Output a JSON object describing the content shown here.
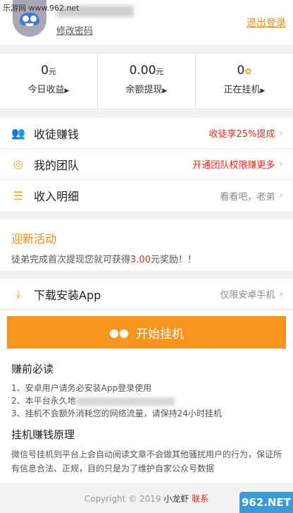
{
  "watermark": "乐游网 www.962.net",
  "header": {
    "change_password": "修改密码",
    "logout": "退出登录"
  },
  "stats": [
    {
      "value": "0",
      "unit": "元",
      "label": "今日收益"
    },
    {
      "value": "0.00",
      "unit": "元",
      "label": "余额提现"
    },
    {
      "value": "0",
      "unit": "",
      "label": "正在挂机"
    }
  ],
  "menu": [
    {
      "label": "收徒赚钱",
      "hint": "收徒享25%提成",
      "icon": "users-icon"
    },
    {
      "label": "我的团队",
      "hint": "开通团队权限赚更多",
      "icon": "lifebuoy-icon"
    },
    {
      "label": "收入明细",
      "hint": "看看吧，老弟",
      "icon": "list-icon"
    }
  ],
  "promo": {
    "title": "迎新活动",
    "text_before": "徒弟完成首次提现您就可获得",
    "amount": "3.00",
    "text_after": "元奖励！！"
  },
  "download": {
    "label": "下载安装App",
    "hint": "仅限安卓手机"
  },
  "start_button": "开始挂机",
  "notice": {
    "title": "赚前必读",
    "items": [
      "1、安卓用户请务必安装App登录使用",
      "2、本平台永久地",
      "3、挂机不会额外消耗您的网络流量，请保持24小时挂机"
    ]
  },
  "principle": {
    "title": "挂机赚钱原理",
    "text": "微信号挂机到平台上会自动阅读文章不会做其他骚扰用户的行为，保证所有信息合法、正规，目的只是为了维护自家公众号数据"
  },
  "footer": {
    "copyright": "Copyright © 2019",
    "link1": "小龙虾",
    "link2": "联系"
  },
  "logo": "962.NET",
  "colors": {
    "accent": "#f7941d",
    "highlight": "#e0301e"
  }
}
